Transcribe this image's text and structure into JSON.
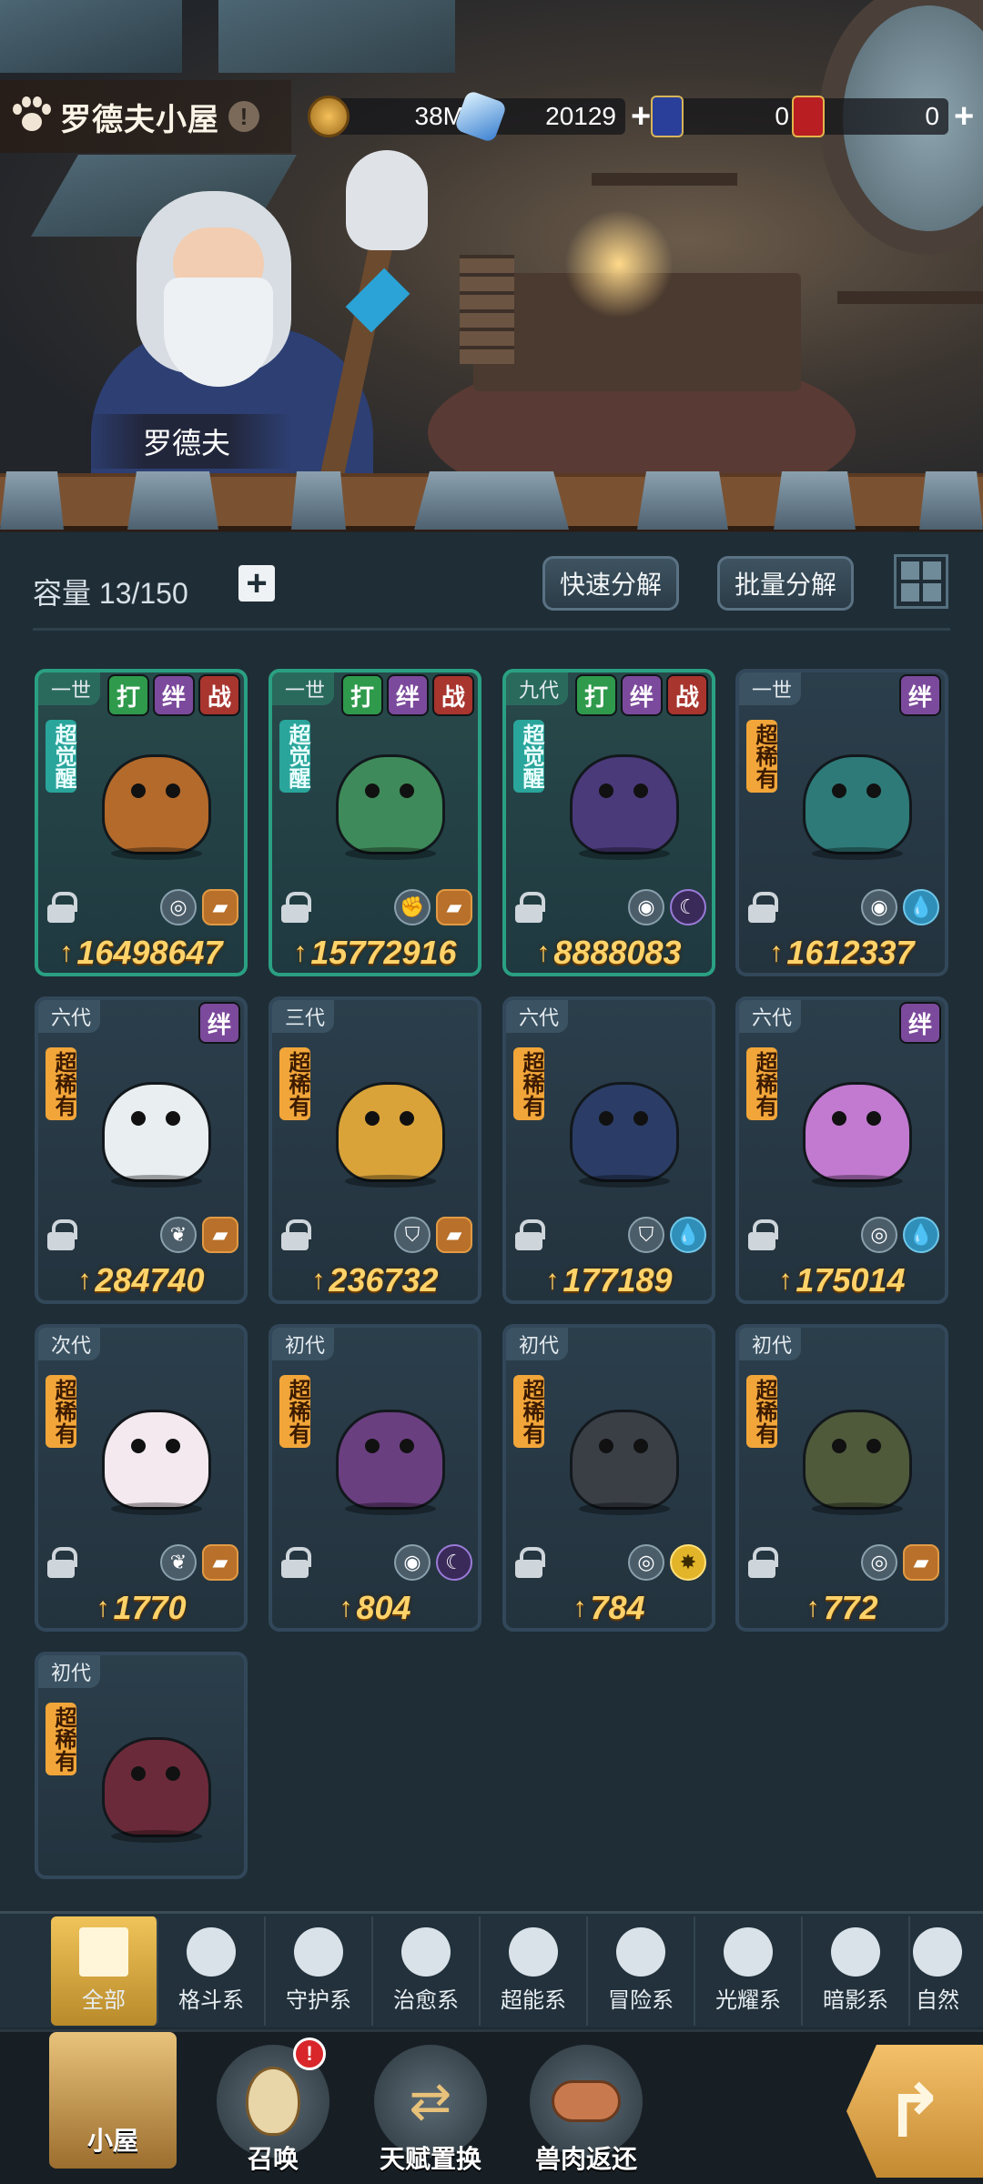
{
  "header": {
    "title": "罗德夫小屋",
    "character_name": "罗德夫",
    "resources": [
      {
        "icon": "gold-coin-icon",
        "value": "38M",
        "has_plus": false
      },
      {
        "icon": "crystal-icon",
        "value": "20129",
        "has_plus": true
      },
      {
        "icon": "blue-card-icon",
        "value": "0",
        "has_plus": false
      },
      {
        "icon": "gold-card-icon",
        "value": "0",
        "has_plus": true
      }
    ]
  },
  "inventory": {
    "capacity_label": "容量 13/150",
    "quick_decompose": "快速分解",
    "batch_decompose": "批量分解",
    "cards": [
      {
        "gen": "一世",
        "tags": [
          "打",
          "绊",
          "战"
        ],
        "rarity": "超觉醒",
        "rarity_type": "awake",
        "elements": [
          "◎",
          "beast"
        ],
        "power": "16498647",
        "awakened": true,
        "color": "#b36a2b"
      },
      {
        "gen": "一世",
        "tags": [
          "打",
          "绊",
          "战"
        ],
        "rarity": "超觉醒",
        "rarity_type": "awake",
        "elements": [
          "✊",
          "beast"
        ],
        "power": "15772916",
        "awakened": true,
        "color": "#3f8a5a"
      },
      {
        "gen": "九代",
        "tags": [
          "打",
          "绊",
          "战"
        ],
        "rarity": "超觉醒",
        "rarity_type": "awake",
        "elements": [
          "dark-eye",
          "moon"
        ],
        "power": "8888083",
        "awakened": true,
        "color": "#4a3a7a"
      },
      {
        "gen": "一世",
        "tags": [
          "绊"
        ],
        "rarity": "超稀有",
        "rarity_type": "super",
        "elements": [
          "dark-eye",
          "water"
        ],
        "power": "1612337",
        "awakened": false,
        "color": "#2e7a78"
      },
      {
        "gen": "六代",
        "tags": [
          "绊"
        ],
        "rarity": "超稀有",
        "rarity_type": "super",
        "elements": [
          "leaf",
          "beast"
        ],
        "power": "284740",
        "awakened": false,
        "color": "#e9eef0"
      },
      {
        "gen": "三代",
        "tags": [],
        "rarity": "超稀有",
        "rarity_type": "super",
        "elements": [
          "shield",
          "beast"
        ],
        "power": "236732",
        "awakened": false,
        "color": "#d9a33a"
      },
      {
        "gen": "六代",
        "tags": [],
        "rarity": "超稀有",
        "rarity_type": "super",
        "elements": [
          "shield",
          "water"
        ],
        "power": "177189",
        "awakened": false,
        "color": "#2b3d66"
      },
      {
        "gen": "六代",
        "tags": [
          "绊"
        ],
        "rarity": "超稀有",
        "rarity_type": "super",
        "elements": [
          "◎",
          "water"
        ],
        "power": "175014",
        "awakened": false,
        "color": "#c27ad0"
      },
      {
        "gen": "次代",
        "tags": [],
        "rarity": "超稀有",
        "rarity_type": "super",
        "elements": [
          "leaf",
          "beast"
        ],
        "power": "1770",
        "awakened": false,
        "color": "#f3e9ee"
      },
      {
        "gen": "初代",
        "tags": [],
        "rarity": "超稀有",
        "rarity_type": "super",
        "elements": [
          "dark-eye",
          "moon"
        ],
        "power": "804",
        "awakened": false,
        "color": "#6a3f80"
      },
      {
        "gen": "初代",
        "tags": [],
        "rarity": "超稀有",
        "rarity_type": "super",
        "elements": [
          "◎",
          "light"
        ],
        "power": "784",
        "awakened": false,
        "color": "#3a3f46"
      },
      {
        "gen": "初代",
        "tags": [],
        "rarity": "超稀有",
        "rarity_type": "super",
        "elements": [
          "◎",
          "beast"
        ],
        "power": "772",
        "awakened": false,
        "color": "#4f5a3b"
      },
      {
        "gen": "初代",
        "tags": [],
        "rarity": "超稀有",
        "rarity_type": "super",
        "elements": [],
        "power": "",
        "awakened": false,
        "color": "#6b2a3a"
      }
    ]
  },
  "categories": [
    {
      "label": "全部",
      "icon": "all-blocks-icon",
      "active": true
    },
    {
      "label": "格斗系",
      "icon": "fist-icon",
      "active": false
    },
    {
      "label": "守护系",
      "icon": "shield-icon",
      "active": false
    },
    {
      "label": "治愈系",
      "icon": "sprout-icon",
      "active": false
    },
    {
      "label": "超能系",
      "icon": "alien-head-icon",
      "active": false
    },
    {
      "label": "冒险系",
      "icon": "lantern-icon",
      "active": false
    },
    {
      "label": "光耀系",
      "icon": "star-burst-icon",
      "active": false
    },
    {
      "label": "暗影系",
      "icon": "dark-eye-icon",
      "active": false
    },
    {
      "label": "自然",
      "icon": "leaf-icon",
      "active": false
    }
  ],
  "nav": [
    {
      "label": "小屋",
      "icon": "hut-icon",
      "active": true,
      "badge": ""
    },
    {
      "label": "召唤",
      "icon": "egg-icon",
      "active": false,
      "badge": "!"
    },
    {
      "label": "天赋置换",
      "icon": "swap-arrows-icon",
      "active": false,
      "badge": ""
    },
    {
      "label": "兽肉返还",
      "icon": "meat-icon",
      "active": false,
      "badge": ""
    }
  ]
}
